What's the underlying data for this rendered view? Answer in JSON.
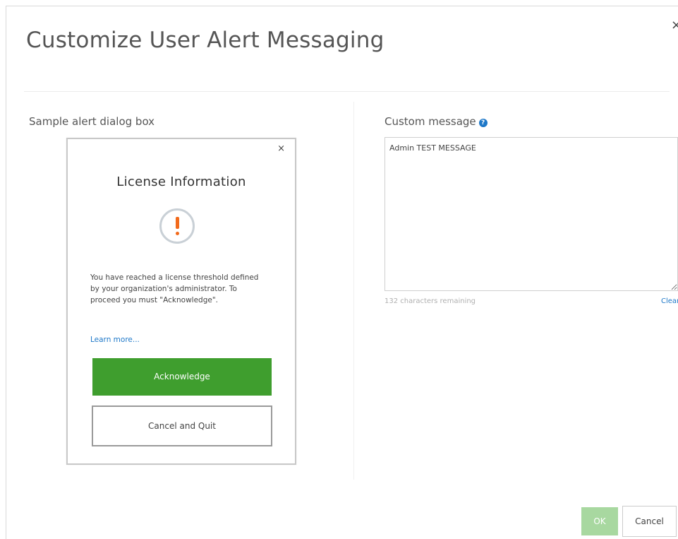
{
  "dialog": {
    "title": "Customize User Alert Messaging",
    "close_glyph": "×"
  },
  "sample": {
    "label": "Sample alert dialog box",
    "close_glyph": "×",
    "title": "License Information",
    "icon": "warning-icon",
    "body": "You have reached a license threshold defined by your organization's administrator. To proceed you must \"Acknowledge\".",
    "link": "Learn more...",
    "acknowledge_label": "Acknowledge",
    "cancel_quit_label": "Cancel and Quit"
  },
  "custom": {
    "label": "Custom message",
    "help_icon": "help-icon",
    "value": "Admin TEST MESSAGE",
    "remaining": "132 characters remaining",
    "clear_label": "Clear"
  },
  "footer": {
    "ok_label": "OK",
    "cancel_label": "Cancel"
  },
  "colors": {
    "accent_blue": "#1e78c8",
    "acknowledge_green": "#3f9e2e",
    "ok_green_disabled": "#a8d8a0",
    "warning_orange": "#f26a1b"
  }
}
